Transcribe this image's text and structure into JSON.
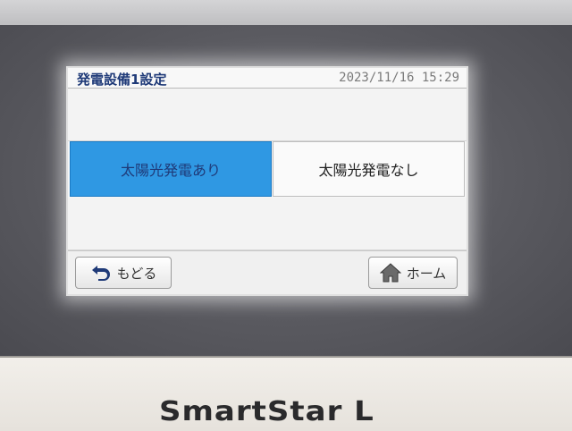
{
  "screen": {
    "title": "発電設備1設定",
    "datetime": "2023/11/16 15:29"
  },
  "options": [
    {
      "label": "太陽光発電あり",
      "selected": true
    },
    {
      "label": "太陽光発電なし",
      "selected": false
    }
  ],
  "buttons": {
    "back_label": "もどる",
    "home_label": "ホーム"
  },
  "device": {
    "brand": "SmartStar L"
  },
  "colors": {
    "selected_option": "#2f98e3",
    "title_text": "#1f3a78"
  },
  "icons": {
    "back": "return-arrow-icon",
    "home": "home-icon"
  }
}
